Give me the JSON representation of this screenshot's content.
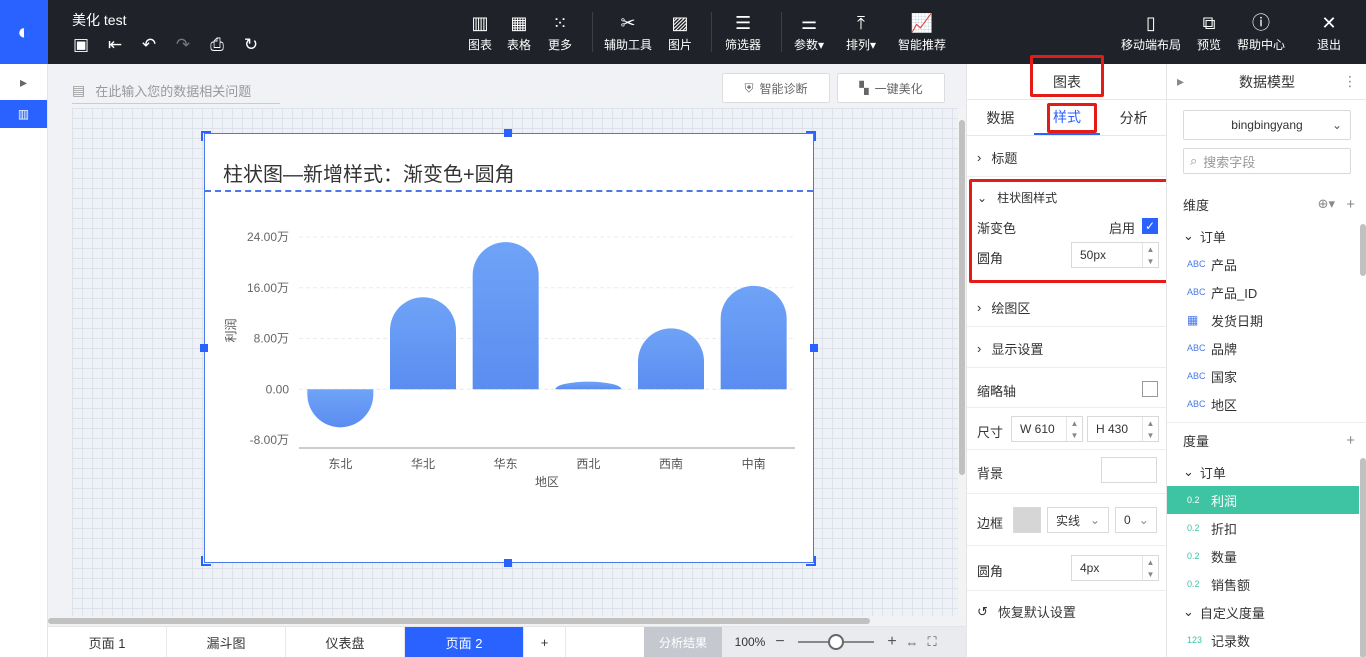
{
  "header": {
    "doc_title": "美化 test",
    "tools": [
      {
        "label": "图表",
        "icon": "bar-chart-icon"
      },
      {
        "label": "表格",
        "icon": "table-icon"
      },
      {
        "label": "更多",
        "icon": "grid-more-icon"
      },
      {
        "label": "辅助工具",
        "icon": "tools-icon"
      },
      {
        "label": "图片",
        "icon": "image-icon"
      },
      {
        "label": "筛选器",
        "icon": "filter-icon"
      },
      {
        "label": "参数▾",
        "icon": "params-icon"
      },
      {
        "label": "排列▾",
        "icon": "arrange-icon"
      },
      {
        "label": "智能推荐",
        "icon": "smart-recommend-icon"
      }
    ],
    "right_tools": [
      {
        "label": "移动端布局",
        "icon": "mobile-icon"
      },
      {
        "label": "预览",
        "icon": "preview-icon"
      },
      {
        "label": "帮助中心",
        "icon": "help-icon"
      },
      {
        "label": "退出",
        "icon": "close-icon"
      }
    ]
  },
  "query_bar": {
    "placeholder": "在此输入您的数据相关问题"
  },
  "buttons": {
    "diagnose": "智能诊断",
    "beautify": "一键美化"
  },
  "chart_data": {
    "type": "bar",
    "title": "柱状图—新增样式：渐变色+圆角",
    "xlabel": "地区",
    "ylabel": "利润",
    "categories": [
      "东北",
      "华北",
      "华东",
      "西北",
      "西南",
      "中南"
    ],
    "values": [
      -60000,
      145000,
      232000,
      12000,
      96000,
      163000
    ],
    "ylim": [
      -80000,
      240000
    ],
    "yticks": [
      -80000,
      0,
      80000,
      160000,
      240000
    ],
    "ytick_labels": [
      "-8.00万",
      "0.00",
      "8.00万",
      "16.00万",
      "24.00万"
    ],
    "bar_color": "#6fa3f7",
    "gradient": true,
    "rounded": true
  },
  "page_tabs": [
    {
      "label": "页面 1",
      "active": false
    },
    {
      "label": "漏斗图",
      "active": false
    },
    {
      "label": "仪表盘",
      "active": false
    },
    {
      "label": "页面 2",
      "active": true
    },
    {
      "label": "+",
      "active": false
    }
  ],
  "zoom": {
    "analysis": "分析结果",
    "value": "100%"
  },
  "panel": {
    "title": "图表",
    "tabs": [
      "数据",
      "样式",
      "分析"
    ],
    "active_tab": "样式",
    "sections": {
      "title_section": "标题",
      "bar_style": "柱状图样式",
      "gradient_label": "渐变色",
      "gradient_toggle": "启用",
      "radius_label": "圆角",
      "radius_value": "50px",
      "plot_area": "绘图区",
      "display": "显示设置",
      "thumb_axis": "缩略轴",
      "size_label": "尺寸",
      "width": "W 610",
      "height": "H 430",
      "background": "背景",
      "border": "边框",
      "border_style": "实线",
      "border_width": "0",
      "corner_label": "圆角",
      "corner_value": "4px",
      "reset": "恢复默认设置"
    }
  },
  "model": {
    "title": "数据模型",
    "dataset": "bingbingyang",
    "search_placeholder": "搜索字段",
    "dimension_label": "维度",
    "dimension_group": "订单",
    "dimensions": [
      {
        "type": "ABC",
        "name": "产品"
      },
      {
        "type": "ABC",
        "name": "产品_ID"
      },
      {
        "type": "date",
        "name": "发货日期"
      },
      {
        "type": "ABC",
        "name": "品牌"
      },
      {
        "type": "ABC",
        "name": "国家"
      },
      {
        "type": "ABC",
        "name": "地区"
      }
    ],
    "measure_label": "度量",
    "measure_group": "订单",
    "measures": [
      {
        "type": "0.2",
        "name": "利润",
        "selected": true
      },
      {
        "type": "0.2",
        "name": "折扣",
        "selected": false
      },
      {
        "type": "0.2",
        "name": "数量",
        "selected": false
      },
      {
        "type": "0.2",
        "name": "销售额",
        "selected": false
      }
    ],
    "custom_group": "自定义度量",
    "custom_measures": [
      {
        "type": "123",
        "name": "记录数"
      }
    ]
  },
  "colors": {
    "accent": "#2962ff",
    "topbar": "#1f2329",
    "selected_row": "#3ec3a3",
    "highlight_box": "#e41b17"
  }
}
